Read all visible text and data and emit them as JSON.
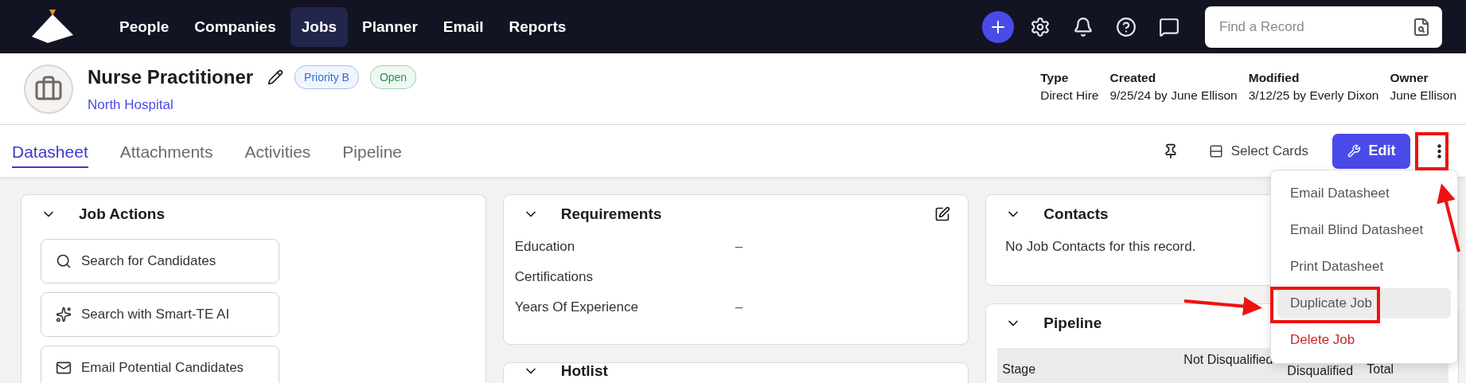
{
  "nav": {
    "items": [
      {
        "label": "People",
        "selected": false
      },
      {
        "label": "Companies",
        "selected": false
      },
      {
        "label": "Jobs",
        "selected": true
      },
      {
        "label": "Planner",
        "selected": false
      },
      {
        "label": "Email",
        "selected": false
      },
      {
        "label": "Reports",
        "selected": false
      }
    ],
    "search": {
      "placeholder": "Find a Record"
    }
  },
  "record": {
    "title": "Nurse Practitioner",
    "company": "North Hospital",
    "badges": [
      {
        "label": "Priority B",
        "color": "#2f6fd6"
      },
      {
        "label": "Open",
        "color": "#1f9a53"
      }
    ],
    "meta": [
      {
        "label": "Type",
        "value": "Direct Hire"
      },
      {
        "label": "Created",
        "value": "9/25/24 by June Ellison"
      },
      {
        "label": "Modified",
        "value": "3/12/25 by Everly Dixon"
      },
      {
        "label": "Owner",
        "value": "June Ellison"
      }
    ]
  },
  "tabs": [
    {
      "label": "Datasheet",
      "selected": true
    },
    {
      "label": "Attachments",
      "selected": false
    },
    {
      "label": "Activities",
      "selected": false
    },
    {
      "label": "Pipeline",
      "selected": false
    }
  ],
  "toolbar": {
    "select_cards": "Select Cards",
    "edit": "Edit"
  },
  "job_actions": {
    "title": "Job Actions",
    "actions": [
      {
        "label": "Search for Candidates",
        "kind": "search"
      },
      {
        "label": "Search with Smart-TE AI",
        "kind": "ai"
      },
      {
        "label": "Email Potential Candidates",
        "kind": "email"
      }
    ]
  },
  "requirements": {
    "title": "Requirements",
    "fields": [
      {
        "label": "Education",
        "value": "–"
      },
      {
        "label": "Certifications"
      },
      {
        "label": "Years Of Experience",
        "value": "–"
      }
    ]
  },
  "hotlist": {
    "title": "Hotlist"
  },
  "contacts": {
    "title": "Contacts",
    "empty_text": "No Job Contacts for this record."
  },
  "pipeline": {
    "title": "Pipeline",
    "columns": [
      "Stage",
      "Not Disqualified",
      "Disqualified",
      "Total"
    ]
  },
  "menu": {
    "items": [
      {
        "label": "Email Datasheet",
        "kind": "normal",
        "selected": false
      },
      {
        "label": "Email Blind Datasheet",
        "kind": "normal",
        "selected": false
      },
      {
        "label": "Print Datasheet",
        "kind": "normal",
        "selected": false
      },
      {
        "label": "Duplicate Job",
        "kind": "normal",
        "selected": true
      },
      {
        "label": "Delete Job",
        "kind": "danger",
        "selected": false
      }
    ]
  }
}
